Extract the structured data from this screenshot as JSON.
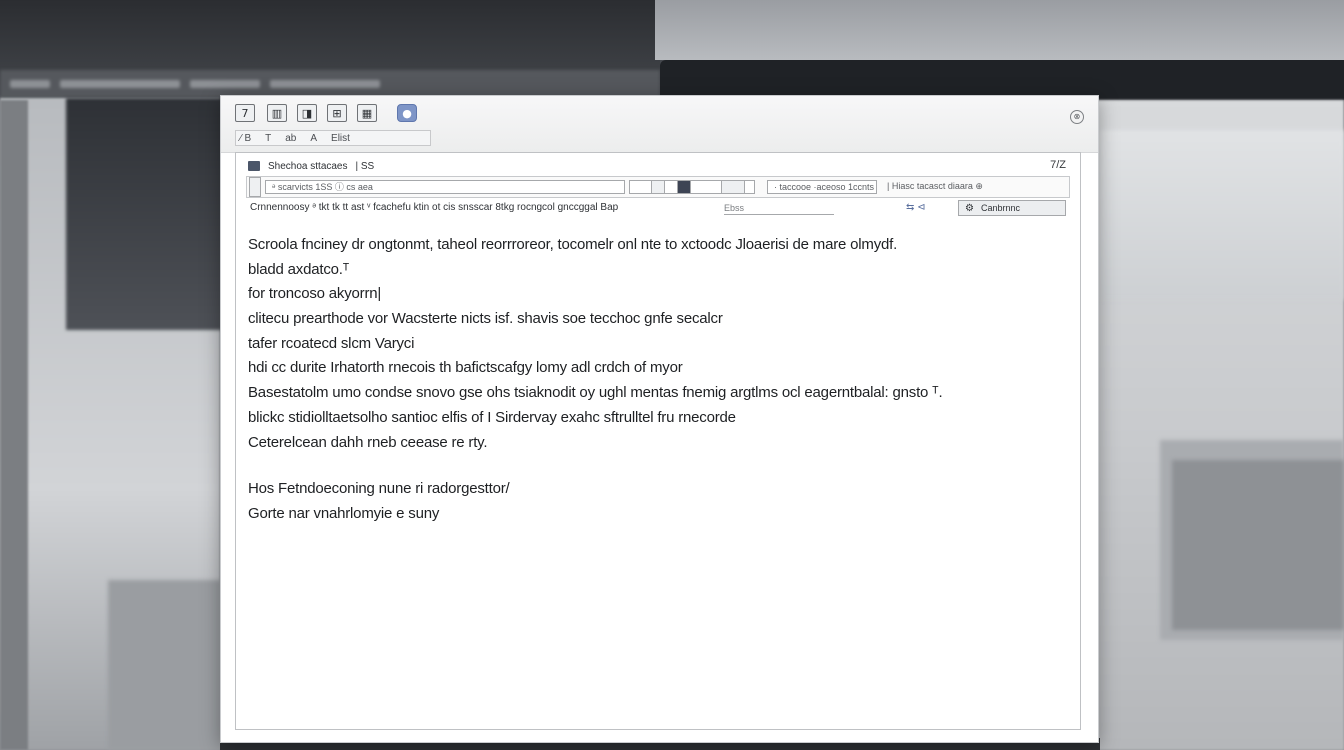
{
  "background": {
    "accent": "#7e95c7"
  },
  "dialog": {
    "toolbar": {
      "buttons": [
        "7",
        "▥",
        "◨",
        "⊞",
        "▦",
        "●"
      ],
      "row2": [
        "⁄ B",
        "T",
        "ab",
        "A",
        "Elist"
      ]
    },
    "close_symbol": "⊗",
    "header": {
      "title": "Shechoa sttacaes",
      "mark": "|  SS",
      "corner": "7/Z"
    },
    "fields": {
      "field1": "                          ᵊ scarvicts 1SS  ⓘ  cs aea",
      "field2": "",
      "field3": "· taccooe ·aceoso 1ccnts ȯ",
      "field4": "|  Hiasc tacasct diaara  ⊕"
    },
    "options": {
      "label": "Crnnennoosy",
      "text": "ᵊ tkt tk tt ast  ᵛ  fcachefu ktin ot cis snsscar 8tkg rocngcol gnccggal  Bap",
      "field_value": "Ebss",
      "icons": "⇆  ⊲",
      "button_label": "Canbrnnc"
    },
    "body_lines": [
      "Scroola fnciney dr ongtonmt,  taheol reorrroreor,  tocomelr onl nte to  xctoodc  Jloaerisi  de mare olmydf.",
      "bladd  axdatco.ᵀ",
      "for troncoso akyorrn|",
      "clitecu  prearthode  vor  Wacsterte nicts isf​.  shavis  soe  tecchoc  gnfe  secalcr",
      "tafer  rcoatecd  slcm Varyci",
      "hdi  cc durite  Irhatorth  rnecois th bafictscafgy lomy  adl  crdch  of  myor",
      "Basestatolm umo condse  snovo  gse ohs  tsiaknodit  oy  ughl  mentas  fnemig  argtlms  ocl  eagerntbalal:  gnsto  ᵀ.",
      "blickc  stidiolltaetsolho  santioc  elfis  of  I Sirdervay  exahc  sftrulltel fru rnecorde",
      "Ceterelcean  dahh rneb  ceease  re rty."
    ],
    "body_lines_2": [
      "Hos  Fetndoeconing  nune  ri radorgesttor/",
      "Gorte  nar  vnahrlomyie  e suny"
    ]
  }
}
